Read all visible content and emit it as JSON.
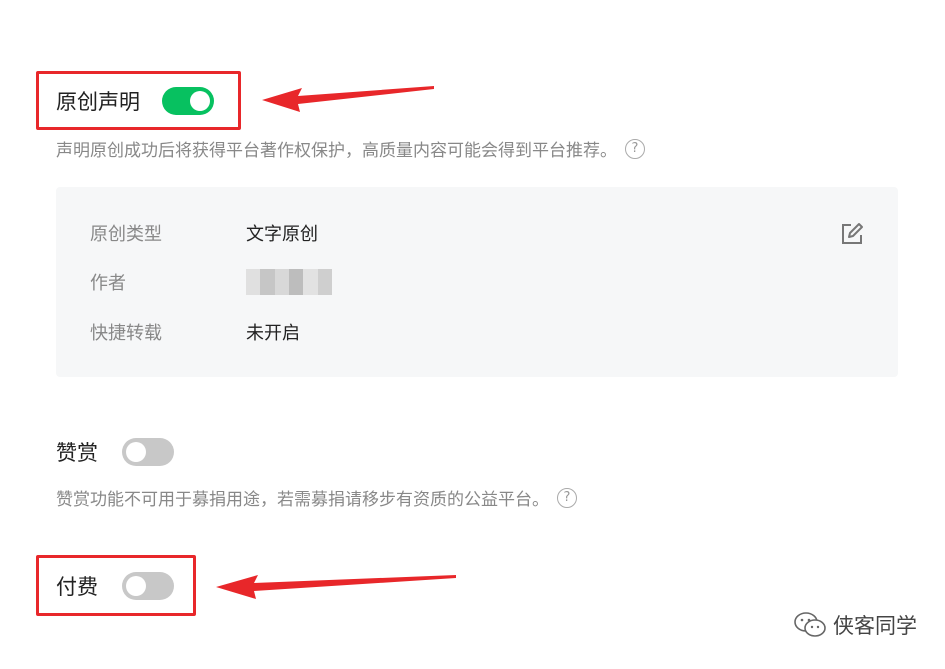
{
  "original": {
    "label": "原创声明",
    "enabled": true,
    "description": "声明原创成功后将获得平台著作权保护，高质量内容可能会得到平台推荐。",
    "details": [
      {
        "key": "原创类型",
        "value": "文字原创"
      },
      {
        "key": "作者",
        "value": ""
      },
      {
        "key": "快捷转载",
        "value": "未开启"
      }
    ]
  },
  "reward": {
    "label": "赞赏",
    "enabled": false,
    "description": "赞赏功能不可用于募捐用途，若需募捐请移步有资质的公益平台。"
  },
  "paid": {
    "label": "付费",
    "enabled": false
  },
  "help_symbol": "?",
  "watermark": {
    "text": "侠客同学",
    "icon": "wechat-icon"
  },
  "colors": {
    "accent": "#07c160",
    "annotation": "#e8272a",
    "toggle_off": "#c8c8c8"
  }
}
